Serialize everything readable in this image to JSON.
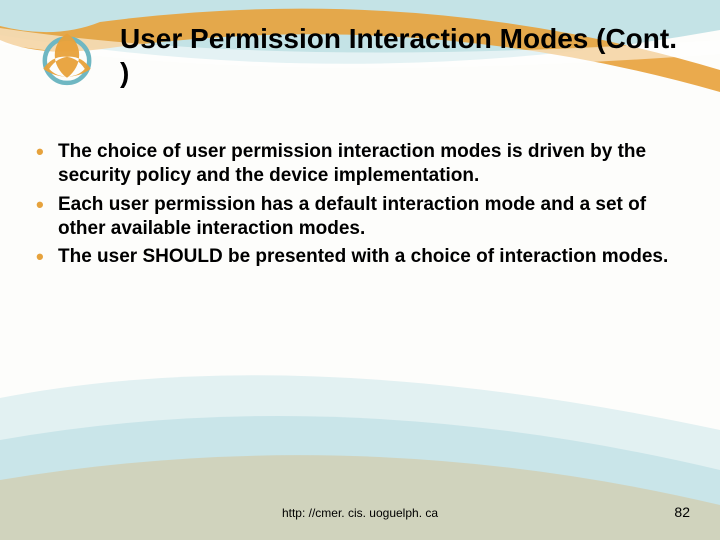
{
  "title": "User Permission Interaction Modes (Cont. )",
  "bullets": [
    "The choice of user permission interaction modes is driven by the security policy and the device implementation.",
    "Each user permission has a default interaction mode and a set of other available interaction modes.",
    "The user SHOULD be presented with a choice of interaction modes."
  ],
  "footer_url": "http: //cmer. cis. uoguelph. ca",
  "page_number": "82"
}
